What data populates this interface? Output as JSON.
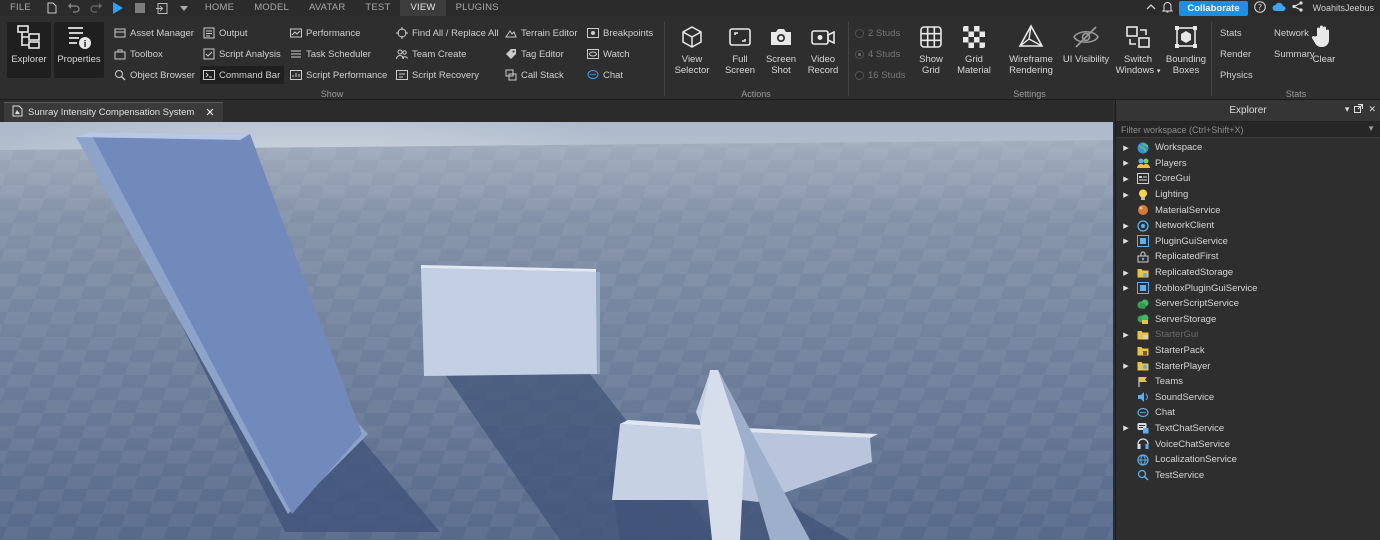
{
  "menubar": {
    "items": [
      "FILE",
      "HOME",
      "MODEL",
      "AVATAR",
      "TEST",
      "VIEW",
      "PLUGINS"
    ],
    "active": "VIEW",
    "collaborate_label": "Collaborate",
    "username": "WoahitsJeebus"
  },
  "ribbon": {
    "show": {
      "label": "Show",
      "explorer": "Explorer",
      "properties": "Properties",
      "col1": [
        "Asset Manager",
        "Toolbox",
        "Object Browser"
      ],
      "col2": [
        "Output",
        "Script Analysis",
        "Command Bar"
      ],
      "col3": [
        "Performance",
        "Task Scheduler",
        "Script Performance"
      ],
      "col4": [
        "Find All / Replace All",
        "Team Create",
        "Script Recovery"
      ],
      "col5": [
        "Terrain Editor",
        "Tag Editor",
        "Call Stack"
      ],
      "col6": [
        "Breakpoints",
        "Watch",
        "Chat"
      ]
    },
    "actions": {
      "label": "Actions",
      "view_selector": [
        "View",
        "Selector"
      ],
      "full_screen": [
        "Full",
        "Screen"
      ],
      "screen_shot": [
        "Screen",
        "Shot"
      ],
      "video_record": [
        "Video",
        "Record"
      ]
    },
    "settings": {
      "label": "Settings",
      "studs": [
        "2 Studs",
        "4 Studs",
        "16 Studs"
      ],
      "show_grid": [
        "Show",
        "Grid"
      ],
      "grid_material": [
        "Grid",
        "Material"
      ],
      "wireframe": [
        "Wireframe",
        "Rendering"
      ],
      "ui_visibility": "UI Visibility",
      "switch_windows": [
        "Switch",
        "Windows"
      ],
      "bounding_boxes": [
        "Bounding",
        "Boxes"
      ]
    },
    "stats": {
      "label": "Stats",
      "items": [
        "Stats",
        "Network",
        "Render",
        "Summary",
        "Physics"
      ],
      "clear": "Clear"
    }
  },
  "document_tab": {
    "title": "Sunray Intensity Compensation System"
  },
  "explorer": {
    "title": "Explorer",
    "filter_placeholder": "Filter workspace (Ctrl+Shift+X)",
    "items": [
      {
        "name": "Workspace",
        "expandable": true,
        "icon": "globe-icon",
        "dim": false
      },
      {
        "name": "Players",
        "expandable": true,
        "icon": "players-icon",
        "dim": false
      },
      {
        "name": "CoreGui",
        "expandable": true,
        "icon": "coregui-icon",
        "dim": false
      },
      {
        "name": "Lighting",
        "expandable": true,
        "icon": "lightbulb-icon",
        "dim": false
      },
      {
        "name": "MaterialService",
        "expandable": false,
        "icon": "material-icon",
        "dim": false
      },
      {
        "name": "NetworkClient",
        "expandable": true,
        "icon": "network-icon",
        "dim": false
      },
      {
        "name": "PluginGuiService",
        "expandable": true,
        "icon": "plugin-gui-icon",
        "dim": false
      },
      {
        "name": "ReplicatedFirst",
        "expandable": false,
        "icon": "replicated-first-icon",
        "dim": false
      },
      {
        "name": "ReplicatedStorage",
        "expandable": true,
        "icon": "replicated-storage-icon",
        "dim": false
      },
      {
        "name": "RobloxPluginGuiService",
        "expandable": true,
        "icon": "plugin-gui-icon",
        "dim": false
      },
      {
        "name": "ServerScriptService",
        "expandable": false,
        "icon": "server-script-icon",
        "dim": false
      },
      {
        "name": "ServerStorage",
        "expandable": false,
        "icon": "server-storage-icon",
        "dim": false
      },
      {
        "name": "StarterGui",
        "expandable": true,
        "icon": "starter-gui-icon",
        "dim": true
      },
      {
        "name": "StarterPack",
        "expandable": false,
        "icon": "starter-pack-icon",
        "dim": false
      },
      {
        "name": "StarterPlayer",
        "expandable": true,
        "icon": "starter-player-icon",
        "dim": false
      },
      {
        "name": "Teams",
        "expandable": false,
        "icon": "teams-icon",
        "dim": false
      },
      {
        "name": "SoundService",
        "expandable": false,
        "icon": "sound-icon",
        "dim": false
      },
      {
        "name": "Chat",
        "expandable": false,
        "icon": "chat-icon",
        "dim": false
      },
      {
        "name": "TextChatService",
        "expandable": true,
        "icon": "text-chat-icon",
        "dim": false
      },
      {
        "name": "VoiceChatService",
        "expandable": false,
        "icon": "voice-chat-icon",
        "dim": false
      },
      {
        "name": "LocalizationService",
        "expandable": false,
        "icon": "localization-icon",
        "dim": false
      },
      {
        "name": "TestService",
        "expandable": false,
        "icon": "test-service-icon",
        "dim": false
      }
    ]
  },
  "colors": {
    "accent": "#1a8fe3",
    "panel": "#2e2e2e",
    "sky_top": "#aab6c9",
    "ground": "#6f819f"
  }
}
